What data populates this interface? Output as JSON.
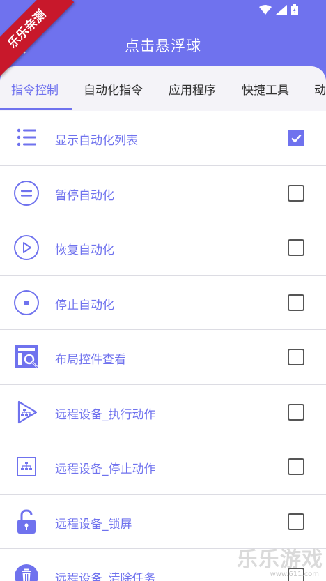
{
  "app": {
    "title": "点击悬浮球"
  },
  "badge": {
    "ribbon_text": "乐乐亲测"
  },
  "tabs": [
    {
      "label": "指令控制",
      "active": true
    },
    {
      "label": "自动化指令",
      "active": false
    },
    {
      "label": "应用程序",
      "active": false
    },
    {
      "label": "快捷工具",
      "active": false
    },
    {
      "label": "动",
      "active": false
    }
  ],
  "items": [
    {
      "label": "显示自动化列表",
      "icon": "list-icon",
      "checked": true
    },
    {
      "label": "暂停自动化",
      "icon": "pause-circle-icon",
      "checked": false
    },
    {
      "label": "恢复自动化",
      "icon": "play-circle-icon",
      "checked": false
    },
    {
      "label": "停止自动化",
      "icon": "stop-circle-icon",
      "checked": false
    },
    {
      "label": "布局控件查看",
      "icon": "layout-inspect-icon",
      "checked": false
    },
    {
      "label": "远程设备_执行动作",
      "icon": "remote-execute-icon",
      "checked": false
    },
    {
      "label": "远程设备_停止动作",
      "icon": "remote-stop-icon",
      "checked": false
    },
    {
      "label": "远程设备_锁屏",
      "icon": "lock-icon",
      "checked": false
    },
    {
      "label": "远程设备_清除任务",
      "icon": "trash-icon",
      "checked": false
    }
  ],
  "watermark": {
    "text": "乐乐游戏",
    "url": "www.611.com"
  },
  "colors": {
    "accent": "#6f72ee",
    "ribbon": "#c8182b"
  }
}
